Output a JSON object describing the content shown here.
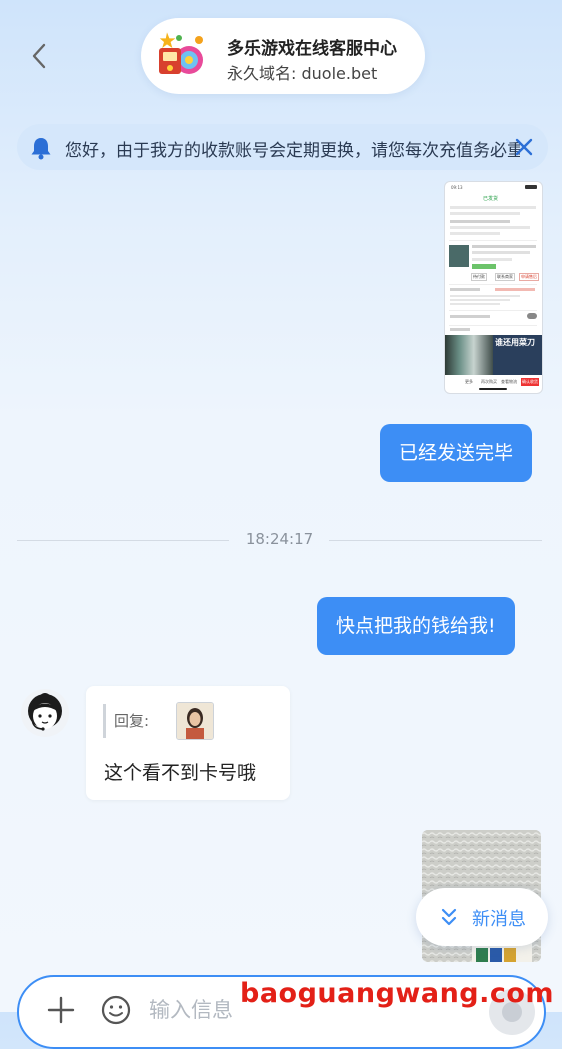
{
  "header": {
    "title": "多乐游戏在线客服中心",
    "subtitle": "永久域名: duole.bet"
  },
  "notice": {
    "text": "您好，由于我方的收款账号会定期更换，请您每次充值务必重新获取最新账号"
  },
  "messages": {
    "sent_1": "已经发送完毕",
    "sent_2": "快点把我的钱给我!",
    "received_reply_label": "回复:",
    "received_text": "这个看不到卡号哦"
  },
  "timestamp": "18:24:17",
  "screenshot": {
    "status_time": "09:13",
    "order_status": "已发货",
    "tab_labels": [
      "待付款",
      "联系商家",
      "申请售后"
    ],
    "banner_text": "谁还用菜刀",
    "bottom_buttons": [
      "更多",
      "再次购买",
      "查看物流",
      "确认收货"
    ]
  },
  "new_message": {
    "label": "新消息"
  },
  "input": {
    "placeholder": "输入信息"
  },
  "watermark": "baoguangwang.com",
  "colors": {
    "accent": "#3d8ef5",
    "outgoing_bubble": "#3d8ef5",
    "watermark": "#e32017"
  },
  "icons": {
    "back": "chevron-left-icon",
    "bell": "bell-icon",
    "close": "close-icon",
    "new_message": "double-chevron-down-icon",
    "plus": "plus-icon",
    "emoji": "emoji-icon",
    "send": "send-icon"
  }
}
